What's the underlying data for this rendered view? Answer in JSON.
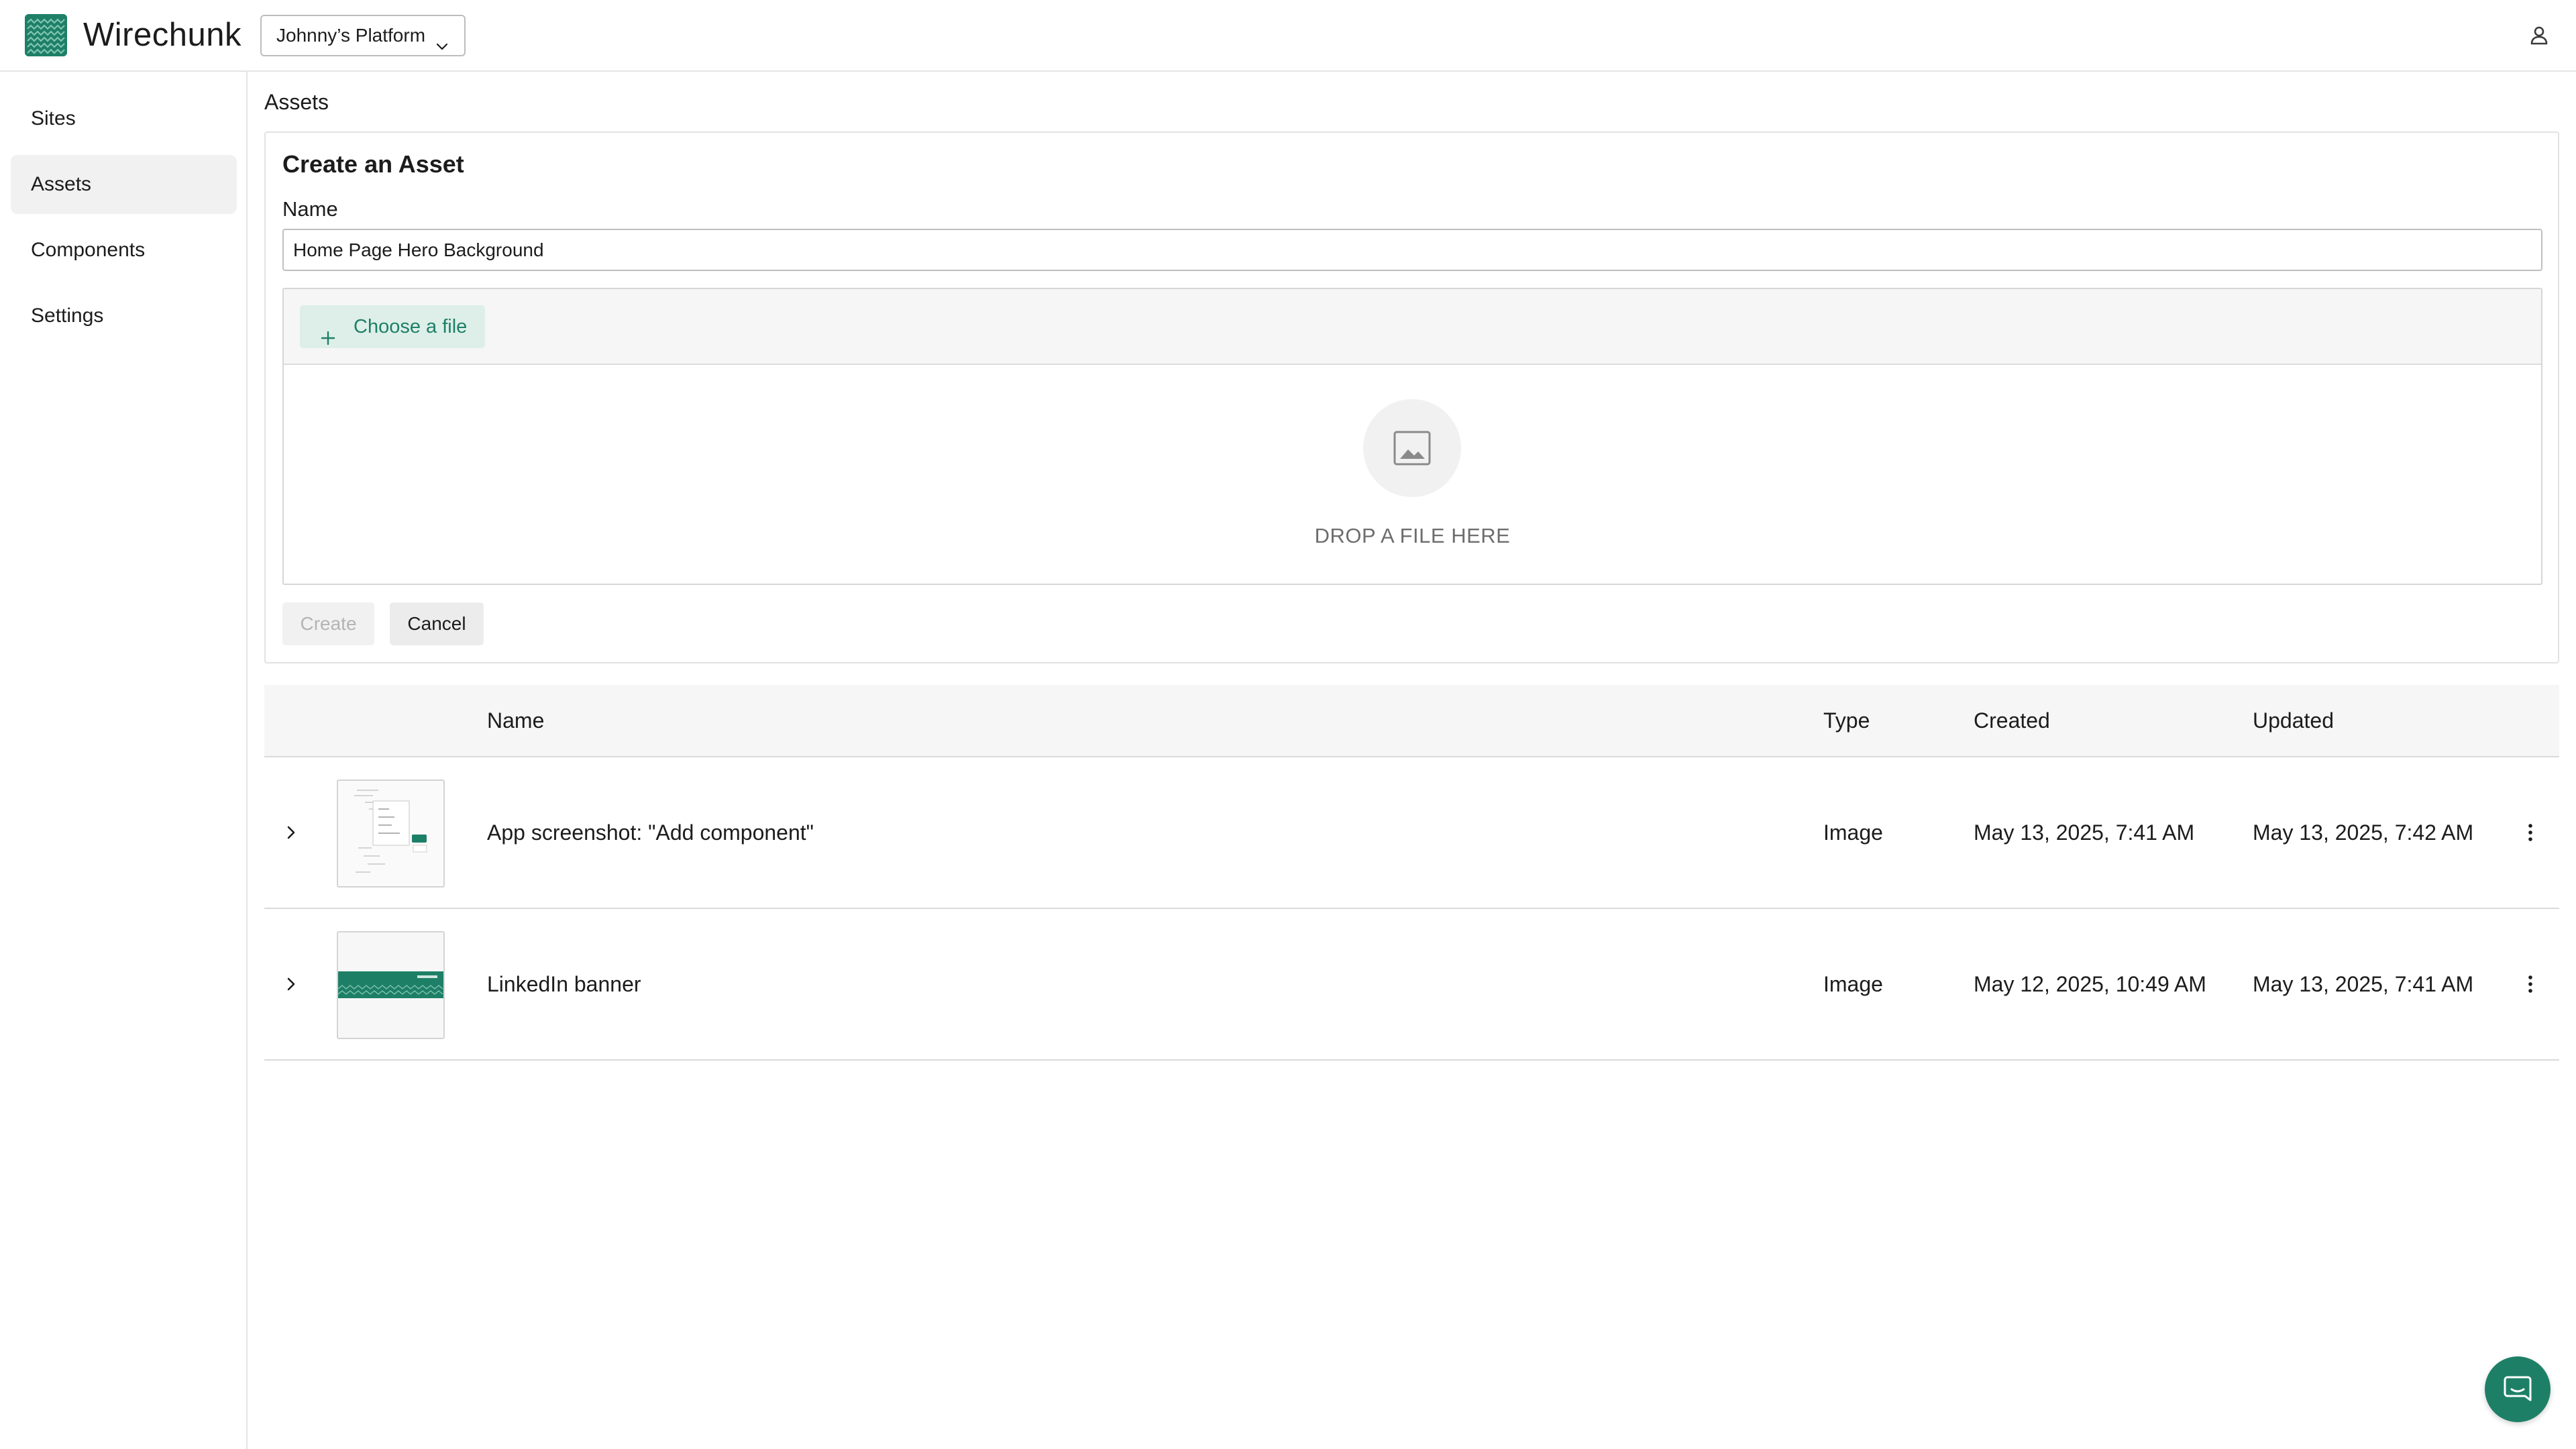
{
  "app": {
    "brand": "Wirechunk",
    "platform_select": "Johnny’s Platform"
  },
  "sidebar": {
    "items": [
      {
        "label": "Sites",
        "active": false
      },
      {
        "label": "Assets",
        "active": true
      },
      {
        "label": "Components",
        "active": false
      },
      {
        "label": "Settings",
        "active": false
      }
    ]
  },
  "main": {
    "section_title": "Assets",
    "create_form": {
      "title": "Create an Asset",
      "name_label": "Name",
      "name_value": "Home Page Hero Background",
      "choose_file_label": "Choose a file",
      "drop_text": "DROP A FILE HERE",
      "create_label": "Create",
      "cancel_label": "Cancel"
    },
    "table": {
      "columns": [
        "Name",
        "Type",
        "Created",
        "Updated"
      ],
      "rows": [
        {
          "name": "App screenshot: \"Add component\"",
          "type": "Image",
          "created": "May 13, 2025, 7:41 AM",
          "updated": "May 13, 2025, 7:42 AM",
          "thumbnail": "app-screenshot-thumbnail"
        },
        {
          "name": "LinkedIn banner",
          "type": "Image",
          "created": "May 12, 2025, 10:49 AM",
          "updated": "May 13, 2025, 7:41 AM",
          "thumbnail": "linkedin-banner-thumbnail"
        }
      ]
    }
  },
  "icons": {
    "logo": "wirechunk-logo",
    "platform_dropdown": "chevron-down-icon",
    "user": "user-icon",
    "add": "plus-icon",
    "drop_placeholder": "image-icon",
    "row_expand": "chevron-right-icon",
    "row_menu": "more-vertical-icon",
    "chat": "chat-icon"
  },
  "colors": {
    "brand": "#1e7f67",
    "brand_light": "#ddefe8",
    "active_nav": "#f0f1f0",
    "table_header": "#f5f6f5"
  }
}
